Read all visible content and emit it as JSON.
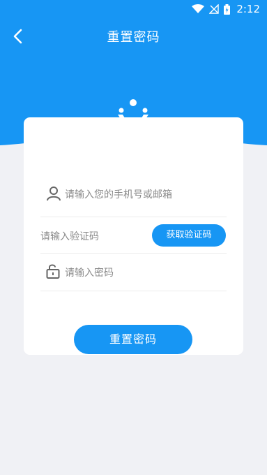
{
  "status_bar": {
    "time": "2:12"
  },
  "header": {
    "title": "重置密码"
  },
  "form": {
    "email_placeholder": "请输入您的手机号或邮箱",
    "code_placeholder": "请输入验证码",
    "get_code_label": "获取验证码",
    "password_placeholder": "请输入密码",
    "submit_label": "重置密码"
  },
  "colors": {
    "primary": "#1796f4",
    "background": "#f0f1f5",
    "card": "#ffffff"
  }
}
